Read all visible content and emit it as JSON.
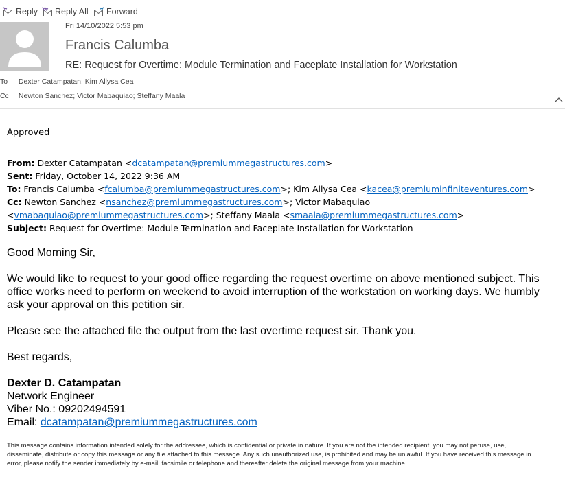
{
  "toolbar": {
    "reply": "Reply",
    "reply_all": "Reply All",
    "forward": "Forward"
  },
  "header": {
    "date": "Fri 14/10/2022 5:53 pm",
    "sender": "Francis Calumba",
    "subject": "RE: Request for Overtime: Module Termination and Faceplate Installation for Workstation",
    "to_label": "To",
    "to": "Dexter Catampatan; Kim Allysa Cea",
    "cc_label": "Cc",
    "cc": "Newton Sanchez; Victor Mabaquiao; Steffany Maala"
  },
  "reply_body": "Approved",
  "original": {
    "from_label": "From:",
    "from_name": " Dexter Catampatan <",
    "from_email": "dcatampatan@premiummegastructures.com",
    "close": ">",
    "sent_label": "Sent:",
    "sent": " Friday, October 14, 2022 9:36 AM",
    "to_label": "To:",
    "to_1_name": " Francis Calumba <",
    "to_1_email": "fcalumba@premiummegastructures.com",
    "to_2_name": ">; Kim Allysa Cea <",
    "to_2_email": "kacea@premiuminfiniteventures.com",
    "cc_label": "Cc:",
    "cc_1_name": " Newton Sanchez <",
    "cc_1_email": "nsanchez@premiummegastructures.com",
    "cc_2_name": ">; Victor Mabaquiao <",
    "cc_2_email": "vmabaquiao@premiummegastructures.com",
    "cc_3_name": ">; Steffany Maala <",
    "cc_3_email": "smaala@premiummegastructures.com",
    "subject_label": "Subject:",
    "subject": " Request for Overtime: Module Termination and Faceplate Installation for Workstation"
  },
  "message": {
    "greeting": "Good Morning Sir,",
    "para1": "We would like to request to your good office regarding the request overtime on above mentioned subject. This office works need to perform on weekend to avoid interruption of the workstation on working days. We humbly ask your approval on this petition sir.",
    "para2": "Please see the attached file the output from the last overtime request sir. Thank you.",
    "closing": "Best regards,"
  },
  "signature": {
    "name": "Dexter D. Catampatan",
    "title": "Network Engineer",
    "viber": "Viber No.: 09202494591",
    "email_label": "Email: ",
    "email": "dcatampatan@premiummegastructures.com"
  },
  "disclaimer": "This message contains information intended solely for the addressee, which is confidential or private in nature. If you are not the intended recipient, you may not peruse, use, disseminate, distribute or copy this message or any file attached to this message. Any such unauthorized use, is prohibited and may be unlawful. If you have received this message in error, please notify the sender immediately by e-mail, facsimile or telephone and thereafter delete the original message from your machine.",
  "colors": {
    "link": "#0563c1",
    "icon_accent": "#7a5aa6",
    "avatar_bg": "#c6c6c6"
  },
  "icons": {
    "reply": "reply-icon",
    "reply_all": "reply-all-icon",
    "forward": "forward-icon",
    "collapse": "chevron-up-icon",
    "avatar": "person-silhouette-icon"
  }
}
